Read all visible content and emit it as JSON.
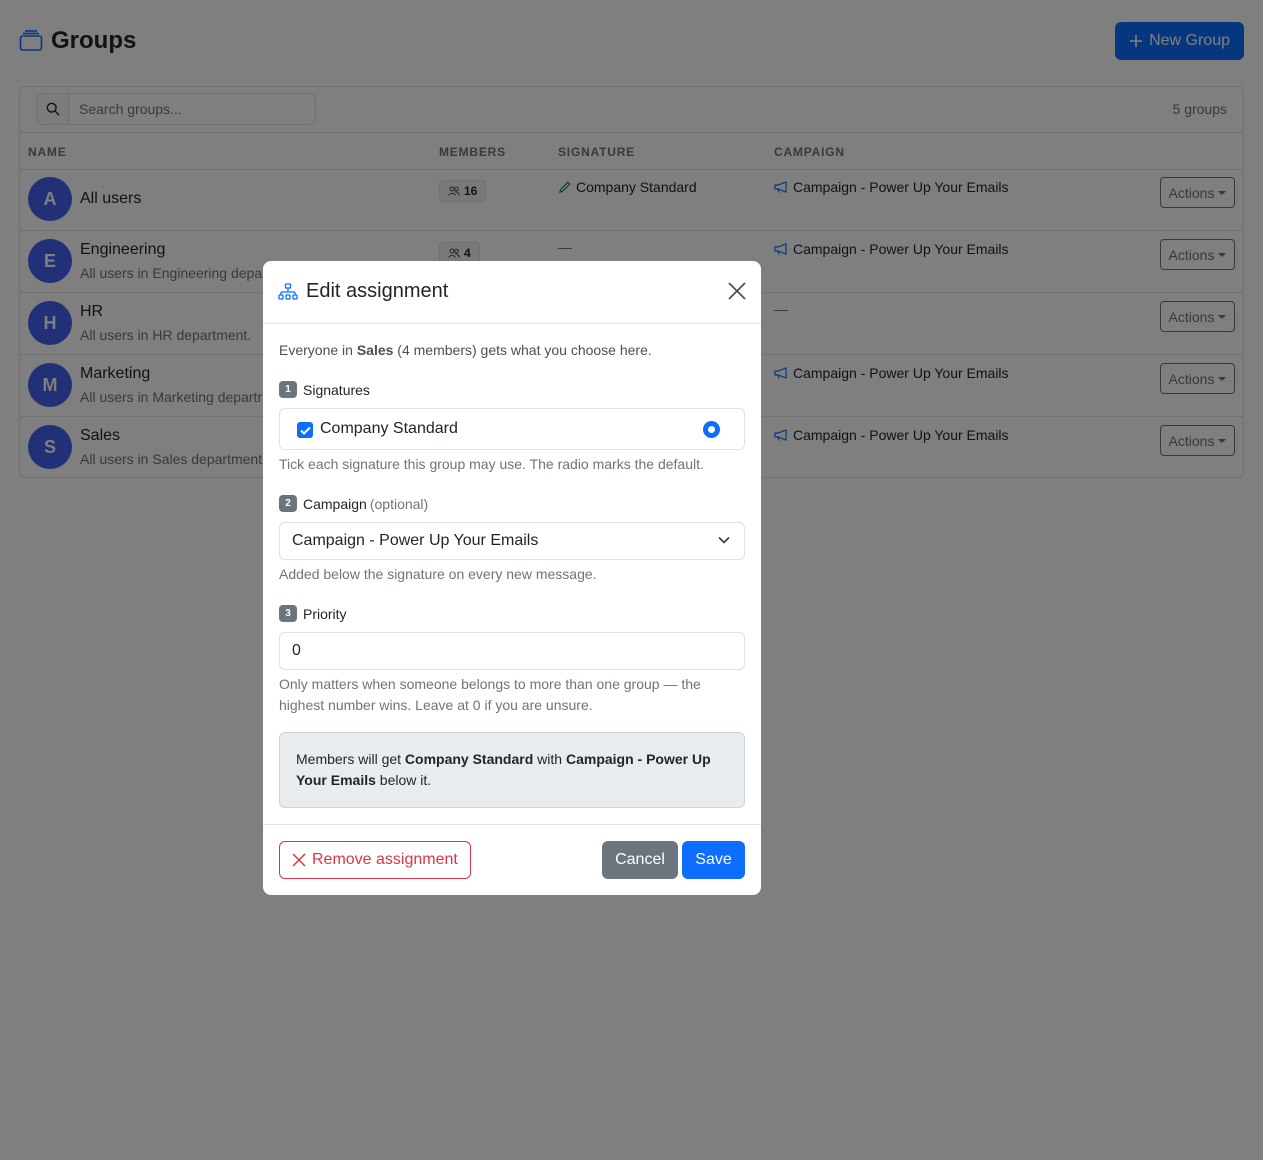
{
  "page": {
    "title": "Groups",
    "new_group_label": "New Group"
  },
  "toolbar": {
    "search_placeholder": "Search groups...",
    "group_count": "5 groups"
  },
  "table": {
    "headers": [
      "NAME",
      "MEMBERS",
      "SIGNATURE",
      "CAMPAIGN"
    ],
    "actions_label": "Actions",
    "rows": [
      {
        "initial": "A",
        "name": "All users",
        "description": "",
        "members": "16",
        "signature": "Company Standard",
        "campaign": "Campaign - Power Up Your Emails"
      },
      {
        "initial": "E",
        "name": "Engineering",
        "description": "All users in Engineering depa",
        "members": "4",
        "signature": "—",
        "campaign": "Campaign - Power Up Your Emails"
      },
      {
        "initial": "H",
        "name": "HR",
        "description": "All users in HR department.",
        "members": "",
        "signature": "",
        "campaign": "—"
      },
      {
        "initial": "M",
        "name": "Marketing",
        "description": "All users in Marketing departr",
        "members": "",
        "signature": "",
        "campaign": "Campaign - Power Up Your Emails"
      },
      {
        "initial": "S",
        "name": "Sales",
        "description": "All users in Sales department",
        "members": "",
        "signature": "",
        "campaign": "Campaign - Power Up Your Emails"
      }
    ]
  },
  "modal": {
    "title": "Edit assignment",
    "intro_prefix": "Everyone in ",
    "intro_group": "Sales",
    "intro_suffix": " (4 members) gets what you choose here.",
    "step1_num": "1",
    "step1_label": "Signatures",
    "signature_option": "Company Standard",
    "signature_help": "Tick each signature this group may use. The radio marks the default.",
    "step2_num": "2",
    "step2_label": "Campaign",
    "step2_optional": "(optional)",
    "campaign_selected": "Campaign - Power Up Your Emails",
    "campaign_help": "Added below the signature on every new message.",
    "step3_num": "3",
    "step3_label": "Priority",
    "priority_value": "0",
    "priority_help_1": "Only matters when someone belongs to more than one group — the",
    "priority_help_2": "highest number wins. Leave at 0 if you are unsure.",
    "summary_1": "Members will get ",
    "summary_sig": "Company Standard",
    "summary_2": " with ",
    "summary_camp_a": "Campaign - Power Up",
    "summary_camp_b": "Your Emails",
    "summary_3": " below it.",
    "remove_label": "Remove assignment",
    "cancel_label": "Cancel",
    "save_label": "Save"
  },
  "colors": {
    "primary": "#0d6efd",
    "danger": "#dc3545",
    "secondary": "#6c757d",
    "avatar": "#4361ee"
  }
}
